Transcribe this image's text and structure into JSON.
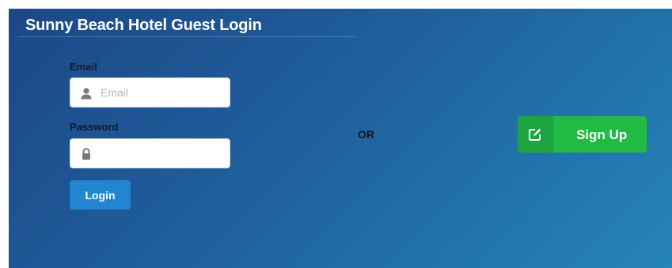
{
  "page": {
    "title": "Sunny Beach Hotel Guest Login",
    "background_gradient": [
      "#1c4788",
      "#2585b6"
    ]
  },
  "login_form": {
    "email": {
      "label": "Email",
      "placeholder": "Email",
      "value": "",
      "icon": "user-icon"
    },
    "password": {
      "label": "Password",
      "placeholder": "",
      "value": "",
      "icon": "lock-icon"
    },
    "login_button": {
      "label": "Login",
      "color": "#2185d0"
    }
  },
  "separator": {
    "text": "OR"
  },
  "signup": {
    "label": "Sign Up",
    "icon": "edit-icon",
    "color": "#21ba45"
  }
}
